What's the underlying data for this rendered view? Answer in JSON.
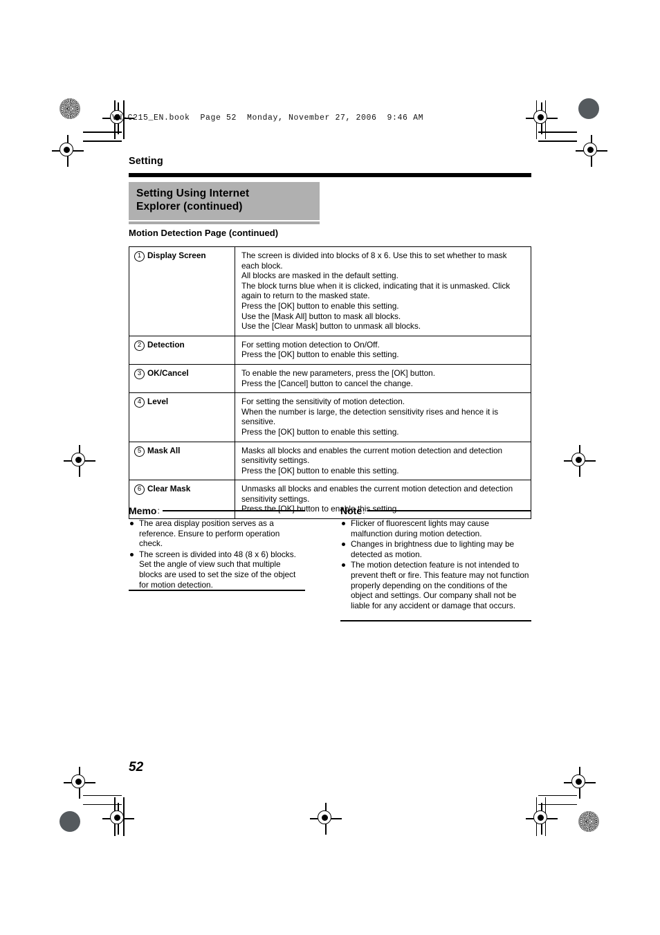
{
  "book_header": "VN-C215_EN.book  Page 52  Monday, November 27, 2006  9:46 AM",
  "running_head": "Setting",
  "title": {
    "line1": "Setting Using Internet",
    "line2": "Explorer (continued)"
  },
  "subhead": "Motion Detection Page (continued)",
  "table": {
    "rows": [
      {
        "num": "1",
        "key": "Display Screen",
        "lines": [
          "The screen is divided into blocks of 8 x 6. Use this to set whether to mask each block.",
          "All blocks are masked in the default setting.",
          "The block turns blue when it is clicked, indicating that it is unmasked. Click again to return to the masked state.",
          "Press the [OK] button to enable this setting.",
          "Use the [Mask All] button to mask all blocks.",
          "Use the [Clear Mask] button to unmask all blocks."
        ]
      },
      {
        "num": "2",
        "key": "Detection",
        "lines": [
          "For setting motion detection to On/Off.",
          "Press the [OK] button to enable this setting."
        ]
      },
      {
        "num": "3",
        "key": "OK/Cancel",
        "lines": [
          "To enable the new parameters, press the [OK] button.",
          "Press the [Cancel] button to cancel the change."
        ]
      },
      {
        "num": "4",
        "key": "Level",
        "lines": [
          "For setting the sensitivity of motion detection.",
          "When the number is large, the detection sensitivity rises and hence it is sensitive.",
          "Press the [OK] button to enable this setting."
        ]
      },
      {
        "num": "5",
        "key": "Mask All",
        "lines": [
          "Masks all blocks and enables the current motion detection and detection sensitivity settings.",
          "Press the [OK] button to enable this setting."
        ]
      },
      {
        "num": "6",
        "key": "Clear Mask",
        "lines": [
          "Unmasks all blocks and enables the current motion detection and detection sensitivity settings.",
          "Press the [OK] button to enable this setting."
        ]
      }
    ]
  },
  "memo": {
    "heading": "Memo",
    "colon": ":",
    "items": [
      "The area display position serves as a reference. Ensure to perform operation check.",
      "The screen is divided into 48 (8 x 6) blocks. Set the angle of view such that multiple blocks are used to set the size of the object for motion detection."
    ]
  },
  "note": {
    "heading": "Note",
    "colon": ":",
    "items": [
      "Flicker of fluorescent lights may cause malfunction during motion detection.",
      "Changes in brightness due to lighting may be detected as motion.",
      "The motion detection feature is not intended to prevent theft or fire. This feature may not function properly depending on the conditions of the object and settings. Our company shall not be liable for any accident or damage that occurs."
    ]
  },
  "folio": "52",
  "colors": {
    "title_box_background": "#b0b0b0",
    "rule_black": "#000000",
    "rule_gray": "#a9a9a9"
  }
}
